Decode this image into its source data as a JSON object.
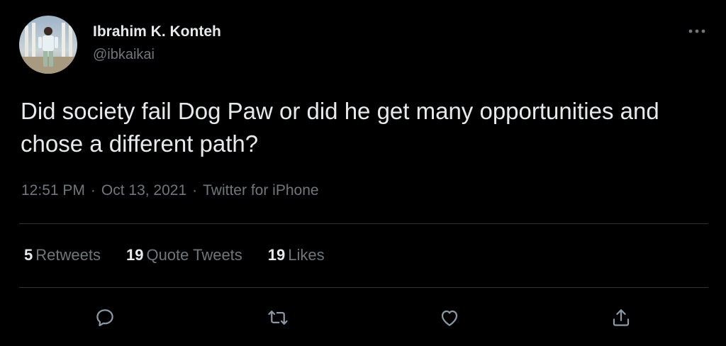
{
  "author": {
    "display_name": "Ibrahim K. Konteh",
    "handle": "@ibkaikai",
    "avatar_icon": "profile-photo"
  },
  "tweet": {
    "text": "Did society fail Dog Paw or did he get many opportunities and chose a different path?",
    "time": "12:51 PM",
    "date": "Oct 13, 2021",
    "separator": "·",
    "source": "Twitter for iPhone"
  },
  "stats": {
    "retweets_count": "5",
    "retweets_label": "Retweets",
    "quote_tweets_count": "19",
    "quote_tweets_label": "Quote Tweets",
    "likes_count": "19",
    "likes_label": "Likes"
  },
  "actions": {
    "reply_icon": "reply-icon",
    "retweet_icon": "retweet-icon",
    "like_icon": "heart-icon",
    "share_icon": "share-icon",
    "more_icon": "more-icon"
  },
  "colors": {
    "background": "#000000",
    "primary_text": "#e7e9ea",
    "secondary_text": "#71767b",
    "divider": "#2f3336"
  }
}
